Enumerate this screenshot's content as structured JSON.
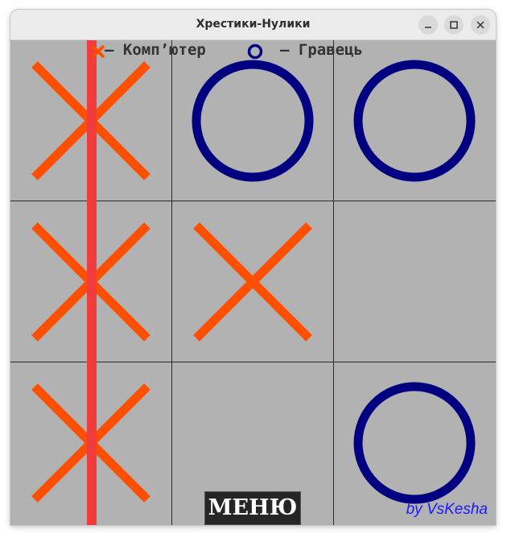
{
  "window": {
    "title": "Хрестики-Нулики"
  },
  "legend": {
    "cross_symbol": "X",
    "computer_label": "– Комп’ютер",
    "nought_symbol": "O",
    "player_label": "– Гравець"
  },
  "board": {
    "cells": [
      {
        "row": 1,
        "col": 1,
        "mark": "X"
      },
      {
        "row": 1,
        "col": 2,
        "mark": "O"
      },
      {
        "row": 1,
        "col": 3,
        "mark": "O"
      },
      {
        "row": 2,
        "col": 1,
        "mark": "X"
      },
      {
        "row": 2,
        "col": 2,
        "mark": "X"
      },
      {
        "row": 2,
        "col": 3,
        "mark": ""
      },
      {
        "row": 3,
        "col": 1,
        "mark": "X"
      },
      {
        "row": 3,
        "col": 2,
        "mark": ""
      },
      {
        "row": 3,
        "col": 3,
        "mark": "O"
      }
    ],
    "winning_line": "column 1"
  },
  "colors": {
    "cross": "#ff4f00",
    "nought": "#000080",
    "winning_line": "#f03c3c",
    "board": "#b2b2b2"
  },
  "menu_button": {
    "label": "МЕНЮ"
  },
  "author": {
    "label": "by VsKesha"
  }
}
